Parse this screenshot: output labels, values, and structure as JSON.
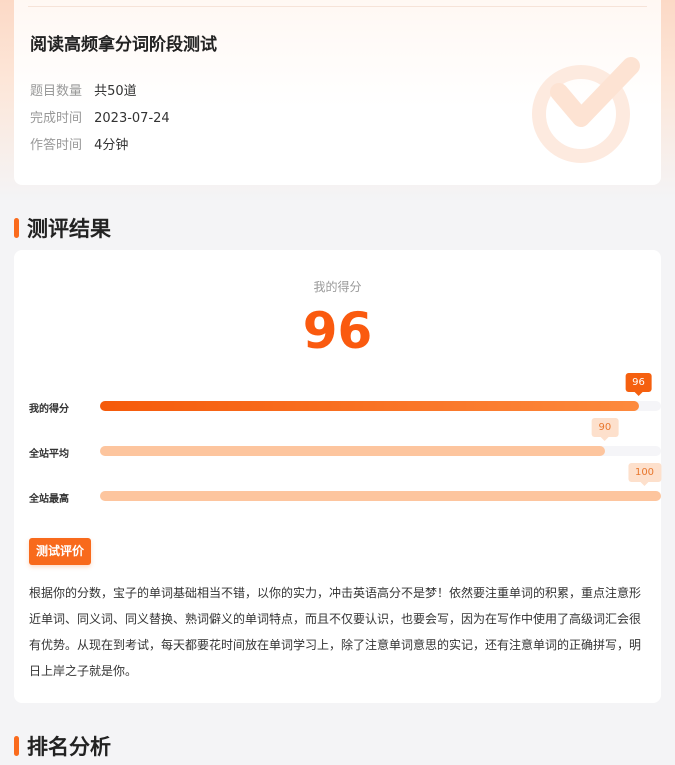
{
  "test_info": {
    "title": "阅读高频拿分词阶段测试",
    "rows": [
      {
        "label": "题目数量",
        "value": "共50道"
      },
      {
        "label": "完成时间",
        "value": "2023-07-24"
      },
      {
        "label": "作答时间",
        "value": "4分钟"
      }
    ]
  },
  "sections": {
    "result_title": "测评结果",
    "ranking_title": "排名分析"
  },
  "result": {
    "score_label": "我的得分",
    "score": "96",
    "bars": [
      {
        "name": "我的得分",
        "value": 96,
        "label": "96"
      },
      {
        "name": "全站平均",
        "value": 90,
        "label": "90"
      },
      {
        "name": "全站最高",
        "value": 100,
        "label": "100"
      }
    ],
    "max_value": 100,
    "eval_tag": "测试评价",
    "eval_text": "根据你的分数，宝子的单词基础相当不错，以你的实力，冲击英语高分不是梦！依然要注重单词的积累，重点注意形近单词、同义词、同义替换、熟词僻义的单词特点，而且不仅要认识，也要会写，因为在写作中使用了高级词汇会很有优势。从现在到考试，每天都要花时间放在单词学习上，除了注意单词意思的实记，还有注意单词的正确拼写，明日上岸之子就是你。"
  },
  "colors": {
    "accent": "#fa5a0f",
    "accent_soft": "#fdc59e",
    "background": "#f4f4f6"
  }
}
